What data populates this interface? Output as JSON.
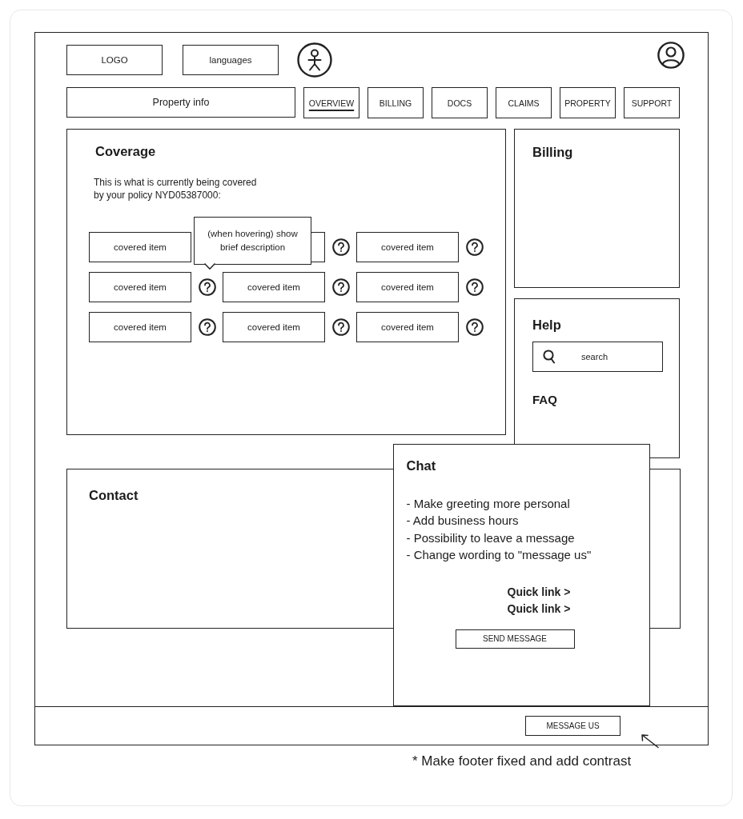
{
  "header": {
    "logo": "LOGO",
    "language_selector": "languages"
  },
  "nav": {
    "property_info": "Property info",
    "tabs": [
      {
        "label": "OVERVIEW",
        "selected": true
      },
      {
        "label": "BILLING",
        "selected": false
      },
      {
        "label": "DOCS",
        "selected": false
      },
      {
        "label": "CLAIMS",
        "selected": false
      },
      {
        "label": "PROPERTY",
        "selected": false
      },
      {
        "label": "SUPPORT",
        "selected": false
      }
    ]
  },
  "coverage": {
    "title": "Coverage",
    "description": "This is what is currently being covered\nby your policy NYD05387000:",
    "tooltip": "(when hovering) show\nbrief description",
    "items": [
      {
        "label": "covered item",
        "help_icon": false,
        "hovered": false
      },
      {
        "help_icon": true,
        "hovered": false
      },
      {
        "label": "covered item",
        "help_icon": true,
        "hovered": false
      },
      {
        "label": "covered item",
        "help_icon": true,
        "hovered": true
      },
      {
        "label": "covered item",
        "help_icon": true,
        "hovered": false
      },
      {
        "label": "covered item",
        "help_icon": true,
        "hovered": false
      },
      {
        "label": "covered item",
        "help_icon": true,
        "hovered": false
      },
      {
        "label": "covered item",
        "help_icon": true,
        "hovered": false
      },
      {
        "label": "covered item",
        "help_icon": true,
        "hovered": false
      }
    ]
  },
  "billing": {
    "title": "Billing"
  },
  "help": {
    "title": "Help",
    "search": {
      "placeholder": "search"
    },
    "faq": "FAQ"
  },
  "contact": {
    "title": "Contact"
  },
  "chat": {
    "title": "Chat",
    "notes": [
      "- Make greeting more personal",
      "- Add business hours",
      "- Possibility to leave a message",
      "- Change wording to \"message us\""
    ],
    "quick_links": [
      "Quick link >",
      "Quick link >"
    ],
    "button": "SEND MESSAGE"
  },
  "footer": {
    "button": "MESSAGE US"
  },
  "annotation": "* Make footer fixed and add contrast"
}
